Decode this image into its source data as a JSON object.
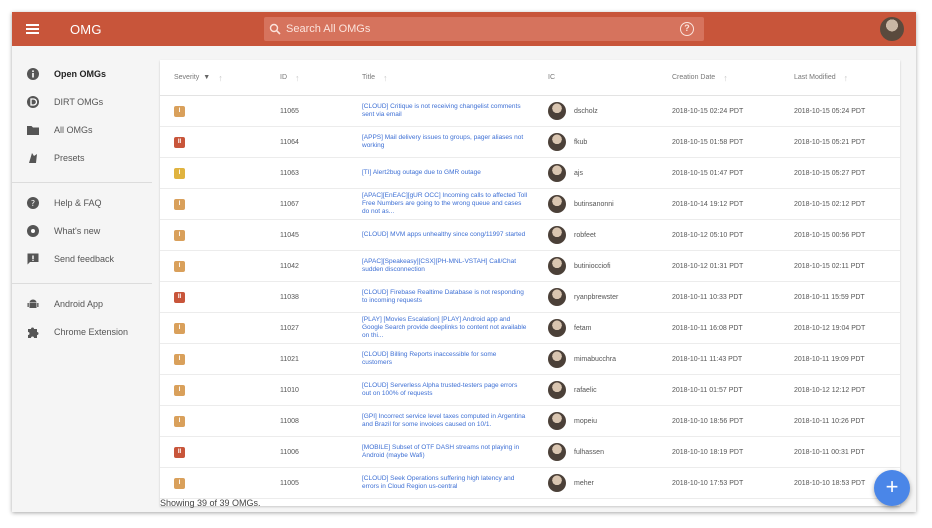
{
  "header": {
    "app_title": "OMG",
    "search_placeholder": "Search All OMGs",
    "help_icon": "?"
  },
  "sidebar": {
    "groups": [
      [
        {
          "label": "Open OMGs",
          "icon": "info-icon",
          "active": true
        },
        {
          "label": "DIRT OMGs",
          "icon": "dirt-icon",
          "active": false
        },
        {
          "label": "All OMGs",
          "icon": "folder-icon",
          "active": false
        },
        {
          "label": "Presets",
          "icon": "presets-icon",
          "active": false
        }
      ],
      [
        {
          "label": "Help & FAQ",
          "icon": "help-icon",
          "active": false
        },
        {
          "label": "What's new",
          "icon": "whats-new-icon",
          "active": false
        },
        {
          "label": "Send feedback",
          "icon": "feedback-icon",
          "active": false
        }
      ],
      [
        {
          "label": "Android App",
          "icon": "android-icon",
          "active": false
        },
        {
          "label": "Chrome Extension",
          "icon": "puzzle-icon",
          "active": false
        }
      ]
    ]
  },
  "table": {
    "headers": {
      "severity": "Severity",
      "id": "ID",
      "title": "Title",
      "user": "IC",
      "created": "Creation Date",
      "modified": "Last Modified"
    },
    "rows": [
      {
        "sev": "I",
        "sev_color": "#d9a05b",
        "id": "11065",
        "title": "[CLOUD] Critique is not receiving changelist comments sent via email",
        "user": "dscholz",
        "created": "2018-10-15 02:24 PDT",
        "modified": "2018-10-15 05:24 PDT"
      },
      {
        "sev": "II",
        "sev_color": "#c8553a",
        "id": "11064",
        "title": "[APPS] Mail delivery issues to groups, pager aliases not working",
        "user": "fkub",
        "created": "2018-10-15 01:58 PDT",
        "modified": "2018-10-15 05:21 PDT"
      },
      {
        "sev": "I",
        "sev_color": "#e0b33f",
        "id": "11063",
        "title": "[TI] Alert2bug outage due to GMR outage",
        "user": "ajs",
        "created": "2018-10-15 01:47 PDT",
        "modified": "2018-10-15 05:27 PDT"
      },
      {
        "sev": "I",
        "sev_color": "#d9a05b",
        "id": "11067",
        "title": "[APAC][EnEAC][gUR OCC] Incoming calls to affected Toll Free Numbers are going to the wrong queue and cases do not as...",
        "user": "butinsanonni",
        "created": "2018-10-14 19:12 PDT",
        "modified": "2018-10-15 02:12 PDT"
      },
      {
        "sev": "I",
        "sev_color": "#d9a05b",
        "id": "11045",
        "title": "[CLOUD] MVM apps unhealthy since cong/11997 started",
        "user": "robfeet",
        "created": "2018-10-12 05:10 PDT",
        "modified": "2018-10-15 00:56 PDT"
      },
      {
        "sev": "I",
        "sev_color": "#d9a05b",
        "id": "11042",
        "title": "[APAC][Speakeasy][CSX][PH-MNL-VSTAH] Call/Chat sudden disconnection",
        "user": "butiniocciofi",
        "created": "2018-10-12 01:31 PDT",
        "modified": "2018-10-15 02:11 PDT"
      },
      {
        "sev": "II",
        "sev_color": "#c8553a",
        "id": "11038",
        "title": "[CLOUD] Firebase Realtime Database is not responding to incoming requests",
        "user": "ryanpbrewster",
        "created": "2018-10-11 10:33 PDT",
        "modified": "2018-10-11 15:59 PDT"
      },
      {
        "sev": "I",
        "sev_color": "#d9a05b",
        "id": "11027",
        "title": "[PLAY] [Movies Escalation] [PLAY] Android app and Google Search provide deeplinks to content not available on thi...",
        "user": "fetam",
        "created": "2018-10-11 16:08 PDT",
        "modified": "2018-10-12 19:04 PDT"
      },
      {
        "sev": "I",
        "sev_color": "#d9a05b",
        "id": "11021",
        "title": "[CLOUD] Billing Reports inaccessible for some customers",
        "user": "mimabucchra",
        "created": "2018-10-11 11:43 PDT",
        "modified": "2018-10-11 19:09 PDT"
      },
      {
        "sev": "I",
        "sev_color": "#d9a05b",
        "id": "11010",
        "title": "[CLOUD] Serverless Alpha trusted-testers page errors out on 100% of requests",
        "user": "rafaelic",
        "created": "2018-10-11 01:57 PDT",
        "modified": "2018-10-12 12:12 PDT"
      },
      {
        "sev": "I",
        "sev_color": "#d9a05b",
        "id": "11008",
        "title": "[GPI] Incorrect service level taxes computed in Argentina and Brazil for some invoices caused on 10/1.",
        "user": "mopeiu",
        "created": "2018-10-10 18:56 PDT",
        "modified": "2018-10-11 10:26 PDT"
      },
      {
        "sev": "II",
        "sev_color": "#c8553a",
        "id": "11006",
        "title": "[MOBILE] Subset of OTF DASH streams not playing in Android (maybe Wafi)",
        "user": "fulhassen",
        "created": "2018-10-10 18:19 PDT",
        "modified": "2018-10-11 00:31 PDT"
      },
      {
        "sev": "I",
        "sev_color": "#d9a05b",
        "id": "11005",
        "title": "[CLOUD] Seek Operations suffering high latency and errors in Cloud Region us-central",
        "user": "meher",
        "created": "2018-10-10 17:53 PDT",
        "modified": "2018-10-10 18:53 PDT"
      }
    ]
  },
  "footer": {
    "status": "Showing 39 of 39 OMGs."
  },
  "fab": {
    "label": "+"
  }
}
